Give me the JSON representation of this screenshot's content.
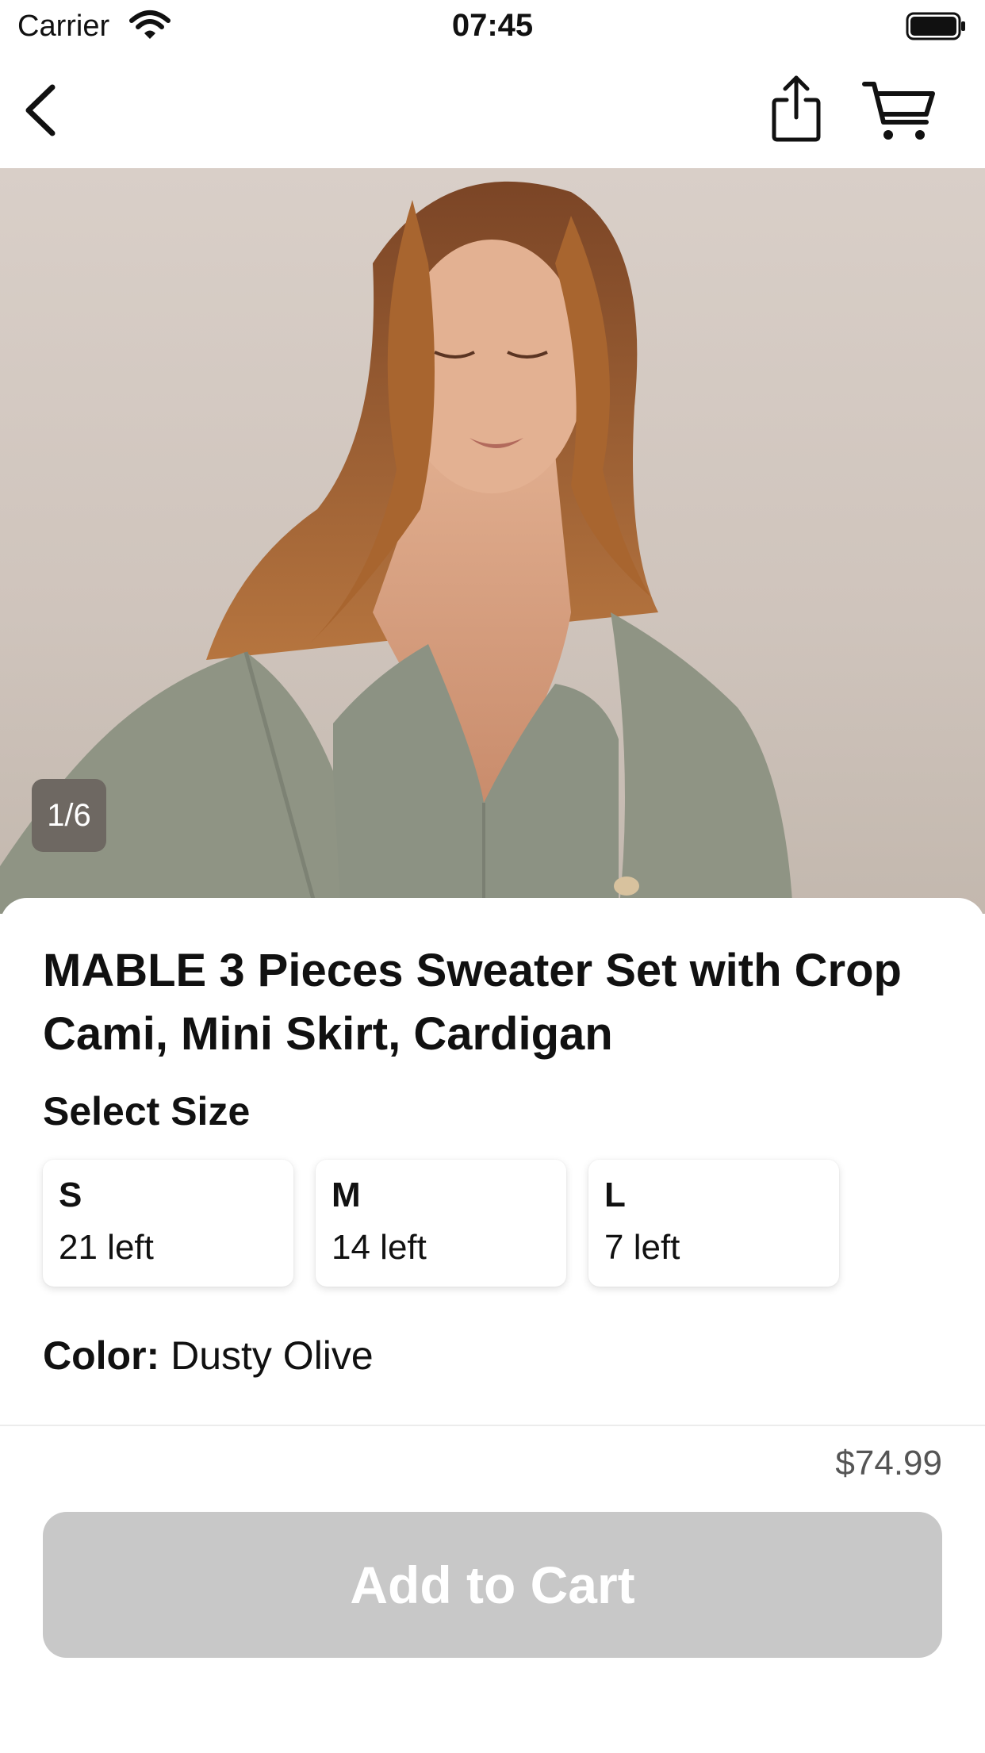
{
  "status_bar": {
    "carrier": "Carrier",
    "time": "07:45"
  },
  "nav": {
    "back_icon": "chevron-left-icon",
    "share_icon": "share-icon",
    "cart_icon": "cart-icon"
  },
  "gallery": {
    "counter": "1/6",
    "current_image": 1,
    "total_images": 6
  },
  "product": {
    "title": "MABLE 3 Pieces Sweater Set with Crop Cami, Mini Skirt, Cardigan",
    "size_section_label": "Select Size",
    "sizes": [
      {
        "name": "S",
        "stock": "21 left"
      },
      {
        "name": "M",
        "stock": "14 left"
      },
      {
        "name": "L",
        "stock": "7 left"
      }
    ],
    "color_label": "Color:",
    "color_value": "Dusty Olive"
  },
  "footer": {
    "price": "$74.99",
    "add_to_cart_label": "Add to Cart"
  },
  "colors": {
    "button_disabled": "#c8c8c8",
    "counter_badge": "#6e6862",
    "sweater": "#8f9484",
    "hair": "#9a5a2e",
    "background": "#d9cfc8"
  }
}
